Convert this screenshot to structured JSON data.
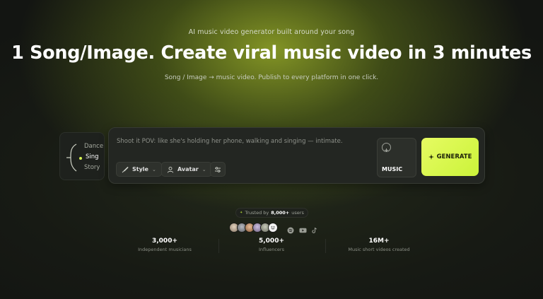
{
  "hero": {
    "eyebrow": "AI music video generator built around your song",
    "title": "1 Song/Image. Create viral music video in 3 minutes",
    "subtitle": "Song / Image → music video. Publish to every platform in one click."
  },
  "modes": {
    "items": [
      "Dance",
      "Sing",
      "Story"
    ],
    "selected": "Sing"
  },
  "prompt": {
    "text": "Shoot it POV: like she's holding her phone, walking and singing — intimate."
  },
  "chips": {
    "style_label": "Style",
    "avatar_label": "Avatar"
  },
  "music": {
    "label": "MUSIC"
  },
  "generate": {
    "label": "GENERATE"
  },
  "trusted": {
    "prefix": "Trusted by",
    "count": "8,000+",
    "suffix": "users"
  },
  "avatars": {
    "colors": [
      "#c9b7a3",
      "#8d8f95",
      "#d2a07a",
      "#b5a3c8",
      "#a9ad9e"
    ]
  },
  "social_icons": [
    "spotify-icon",
    "youtube-icon",
    "tiktok-icon"
  ],
  "stats": [
    {
      "value": "3,000+",
      "label": "Independent musicians"
    },
    {
      "value": "5,000+",
      "label": "Influencers"
    },
    {
      "value": "16M+",
      "label": "Music short videos created"
    }
  ],
  "colors": {
    "accent": "#d6f451",
    "background": "#141613",
    "card": "#232622"
  }
}
